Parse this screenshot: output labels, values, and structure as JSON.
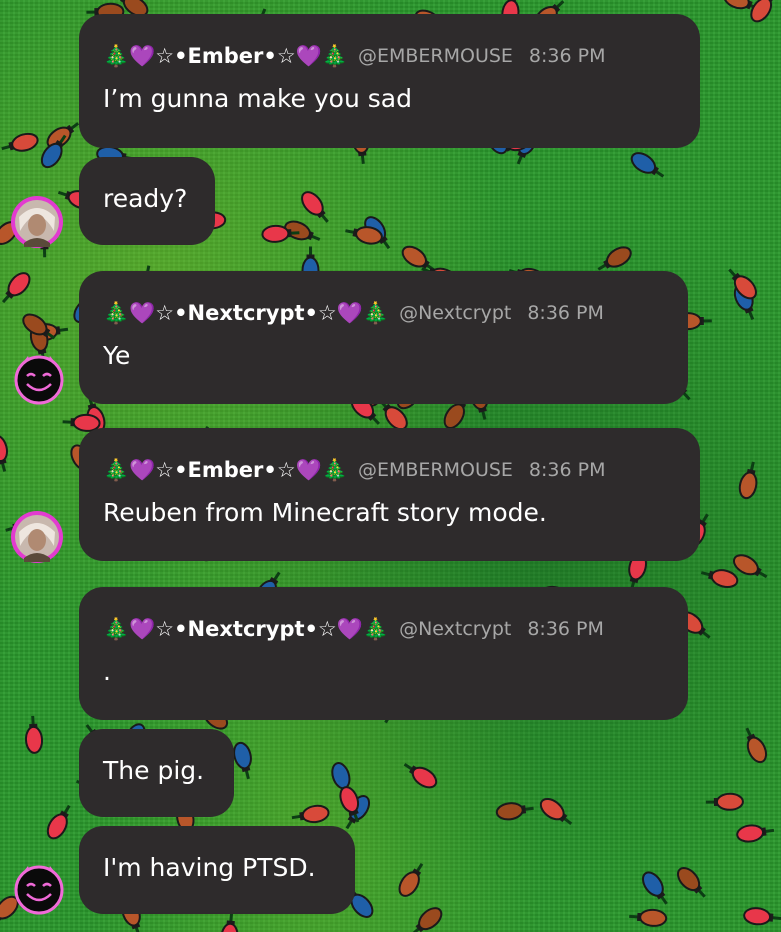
{
  "background": {
    "color": "#2a9a2c",
    "decoration": "christmas-lights-pattern"
  },
  "bubble_color": "#2e2b2c",
  "messages": [
    {
      "display_name": "🎄💜☆•Ember•☆💜🎄",
      "handle": "@EMBERMOUSE",
      "time": "8:36 PM",
      "text": "I’m gunna make you sad"
    },
    {
      "text": "ready?",
      "avatar": "ember-avatar"
    },
    {
      "display_name": "🎄💜☆•Nextcrypt•☆💜🎄",
      "handle": "@Nextcrypt",
      "time": "8:36 PM",
      "text": "Ye",
      "avatar": "nextcrypt-avatar"
    },
    {
      "display_name": "🎄💜☆•Ember•☆💜🎄",
      "handle": "@EMBERMOUSE",
      "time": "8:36 PM",
      "text": "Reuben from Minecraft story mode.",
      "avatar": "ember-avatar"
    },
    {
      "display_name": "🎄💜☆•Nextcrypt•☆💜🎄",
      "handle": "@Nextcrypt",
      "time": "8:36 PM",
      "text": "."
    },
    {
      "text": "The pig."
    },
    {
      "text": "I'm having PTSD.",
      "avatar": "nextcrypt-avatar"
    }
  ]
}
